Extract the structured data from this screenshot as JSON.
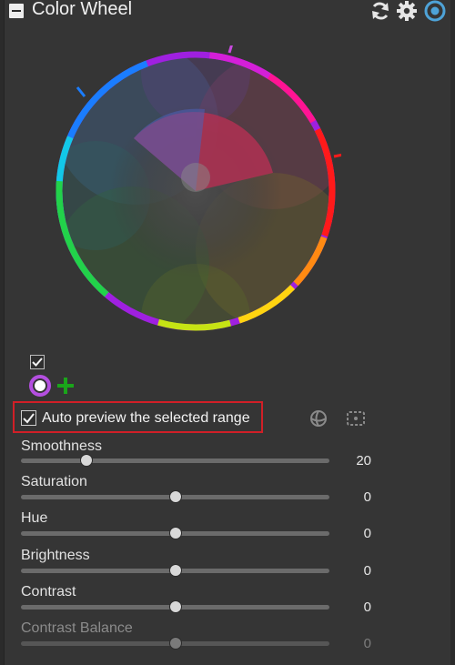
{
  "header": {
    "title": "Color Wheel",
    "icons": [
      "collapse-icon",
      "refresh-icon",
      "gear-icon",
      "target-icon"
    ]
  },
  "wheel": {
    "selection_handles": 3,
    "checkbox_checked": true,
    "icons": [
      "color-picker-icon",
      "add-icon"
    ]
  },
  "auto_preview": {
    "label": "Auto preview the selected range",
    "checked": true,
    "highlight_color": "#d11f27"
  },
  "sliders": [
    {
      "label": "Smoothness",
      "value": "20",
      "fraction": 0.21,
      "enabled": true
    },
    {
      "label": "Saturation",
      "value": "0",
      "fraction": 0.5,
      "enabled": true
    },
    {
      "label": "Hue",
      "value": "0",
      "fraction": 0.5,
      "enabled": true
    },
    {
      "label": "Brightness",
      "value": "0",
      "fraction": 0.5,
      "enabled": true
    },
    {
      "label": "Contrast",
      "value": "0",
      "fraction": 0.5,
      "enabled": true
    },
    {
      "label": "Contrast Balance",
      "value": "0",
      "fraction": 0.5,
      "enabled": false
    }
  ],
  "colors": {
    "background": "#353535",
    "text": "#e6e6e6",
    "disabled_text": "#8b8b8b",
    "accent_blue": "#4ea3d8",
    "picker_purple": "#b44fe0",
    "add_green": "#1aa51a"
  }
}
